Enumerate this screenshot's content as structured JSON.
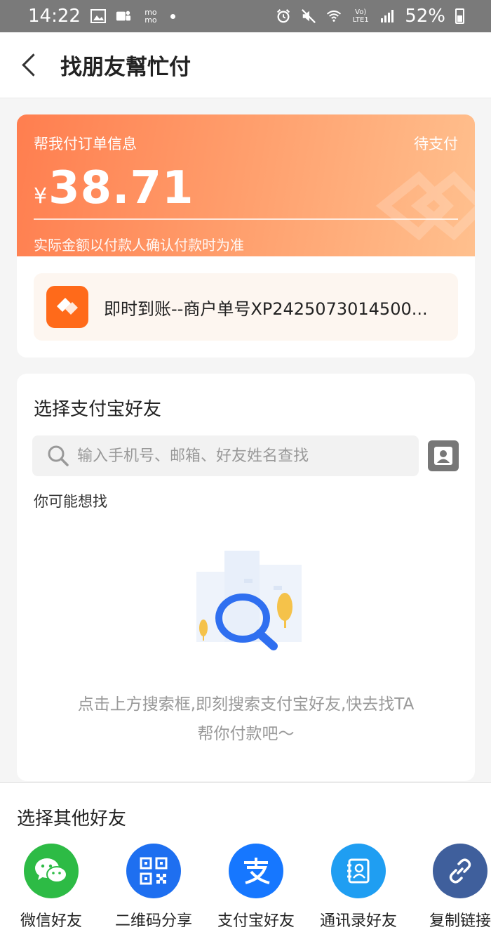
{
  "status_bar": {
    "time": "14:22",
    "battery": "52%",
    "icons": [
      "image-icon",
      "teams-icon",
      "momo-icon",
      "dot-icon",
      "alarm-icon",
      "mute-icon",
      "wifi-icon",
      "volte-icon",
      "signal-icon",
      "battery-icon"
    ],
    "momo_text": "mo mo",
    "volte_text": "Vo) LTE1"
  },
  "header": {
    "title": "找朋友幫忙付"
  },
  "order": {
    "label": "帮我付订单信息",
    "status": "待支付",
    "currency": "¥",
    "amount": "38.71",
    "note": "实际金额以付款人确认付款时为准",
    "merchant_text": "即时到账--商户单号XP2425073014500...",
    "colors": {
      "gradient_start": "#ff7e4f",
      "gradient_end": "#ffc08e",
      "logo": "#ff6a1a"
    }
  },
  "friends": {
    "title": "选择支付宝好友",
    "search_placeholder": "输入手机号、邮箱、好友姓名查找",
    "maybe_label": "你可能想找",
    "empty_line1": "点击上方搜索框,即刻搜索支付宝好友,快去找TA",
    "empty_line2": "帮你付款吧～"
  },
  "others": {
    "title": "选择其他好友",
    "items": [
      {
        "label": "微信好友",
        "icon": "wechat-icon",
        "color": "#2dbb45"
      },
      {
        "label": "二维码分享",
        "icon": "qrcode-icon",
        "color": "#1e6ff0"
      },
      {
        "label": "支付宝好友",
        "icon": "alipay-icon",
        "color": "#1677ff"
      },
      {
        "label": "通讯录好友",
        "icon": "contacts-book-icon",
        "color": "#1f9ef2"
      },
      {
        "label": "复制链接",
        "icon": "link-icon",
        "color": "#3f5f9c"
      }
    ]
  }
}
